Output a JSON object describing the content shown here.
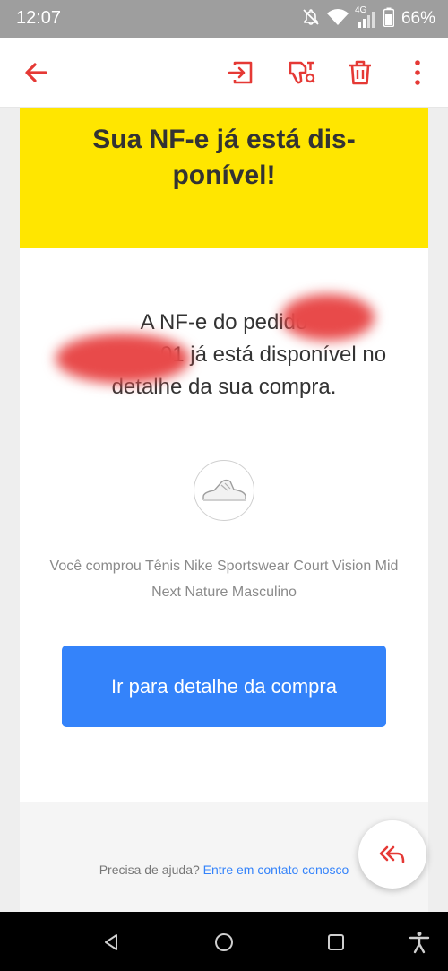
{
  "status_bar": {
    "time": "12:07",
    "network_label": "4G",
    "battery_percent": "66%",
    "icons": [
      "do-not-disturb-icon",
      "wifi-icon",
      "signal-icon",
      "battery-icon"
    ]
  },
  "app_bar": {
    "icons": [
      "back-arrow-icon",
      "move-to-inbox-icon",
      "not-spam-icon",
      "delete-icon",
      "more-options-icon"
    ],
    "accent_color": "#e53935"
  },
  "email": {
    "banner_title": "Sua NF-e já está dis-ponível!",
    "banner_color": "#ffe600",
    "notice_text": "A NF-e do pedido 2000000000000001 já está disponível no detalhe da sua compra.",
    "notice_prefix": "A NF-e do pedido",
    "notice_order_tail": "01",
    "notice_suffix": "já está disponível no detalhe da sua compra.",
    "product_icon": "sneaker-thumbnail",
    "purchase_text": "Você comprou Tênis Nike Sportswear Court Vision Mid Next Nature Masculino",
    "cta_label": "Ir para detalhe da compra",
    "cta_color": "#3483fa",
    "help_prefix": "Precisa de ajuda?",
    "help_link": "Entre em contato conosco"
  },
  "fab": {
    "icon": "reply-all-icon"
  },
  "nav_bar": {
    "icons": [
      "back-triangle-icon",
      "home-circle-icon",
      "recents-square-icon",
      "accessibility-icon"
    ]
  }
}
